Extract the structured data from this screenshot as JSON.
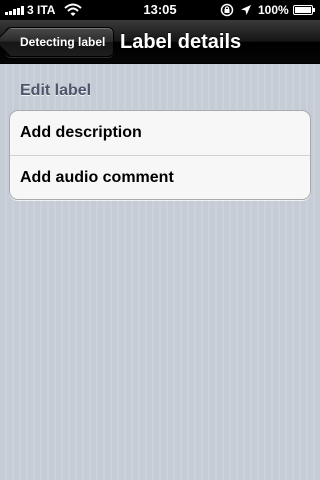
{
  "status_bar": {
    "carrier": "3 ITA",
    "time": "13:05",
    "battery_percent": "100%",
    "icons": [
      "signal-icon",
      "wifi-icon",
      "rotation-lock-icon",
      "location-arrow-icon",
      "battery-icon"
    ]
  },
  "nav": {
    "back_label": "Detecting label",
    "title": "Label details"
  },
  "section": {
    "header": "Edit label",
    "items": [
      {
        "label": "Add description"
      },
      {
        "label": "Add audio comment"
      }
    ]
  },
  "colors": {
    "background": "#c5ccd5",
    "nav_bar": "#000000",
    "section_header": "#4c566c",
    "cell_background": "#f7f7f7"
  }
}
